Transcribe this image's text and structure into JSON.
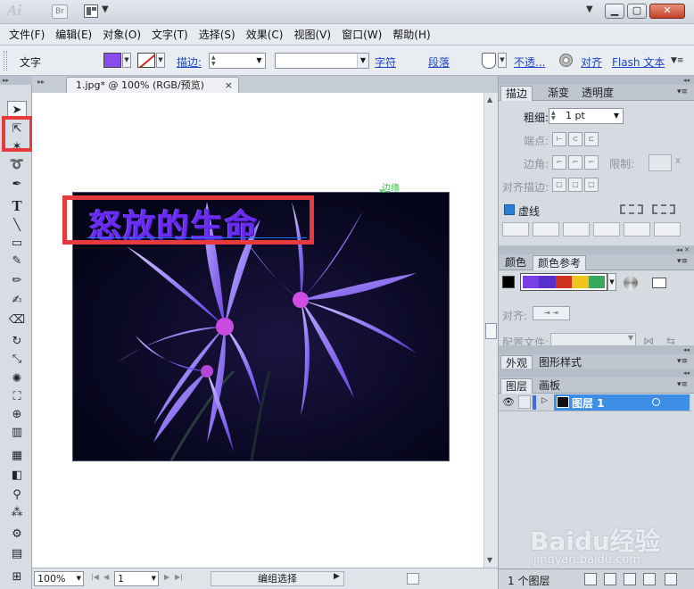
{
  "titlebar": {
    "app_logo": "Ai",
    "bridge_label": "Br"
  },
  "menu": [
    "文件(F)",
    "编辑(E)",
    "对象(O)",
    "文字(T)",
    "选择(S)",
    "效果(C)",
    "视图(V)",
    "窗口(W)",
    "帮助(H)"
  ],
  "control_bar": {
    "mode_label": "文字",
    "fill_color": "#8a4cf0",
    "stroke_link": "描边:",
    "char_link": "字符",
    "para_link": "段落",
    "opacity_link": "不透...",
    "align_link": "对齐",
    "flash_link": "Flash 文本"
  },
  "document": {
    "tab_title": "1.jpg* @ 100% (RGB/预览)",
    "tab_close": "×",
    "artwork_text": "怒放的生命",
    "edge_hint": "边缘",
    "artwork_text_color": "#6a2cf2"
  },
  "status_bar": {
    "zoom": "100%",
    "page": "1",
    "status_text": "编组选择"
  },
  "stroke_panel": {
    "tabs": [
      "描边",
      "渐变",
      "透明度"
    ],
    "weight_label": "粗细:",
    "weight_value": "1 pt",
    "cap_label": "端点:",
    "corner_label": "边角:",
    "limit_label": "限制:",
    "align_label": "对齐描边:",
    "dashed_label": "虚线"
  },
  "color_panel": {
    "tabs": [
      "颜色",
      "颜色参考"
    ],
    "harmony_colors": [
      "#7b3fe6",
      "#5a2fd0",
      "#d2331e",
      "#eec51a",
      "#3aa85a"
    ],
    "align_label": "对齐:",
    "profile_label": "配置文件:"
  },
  "appearance_panel": {
    "tabs": [
      "外观",
      "图形样式"
    ]
  },
  "layers_panel": {
    "tabs": [
      "图层",
      "画板"
    ],
    "layer_name": "图层 1",
    "layer_color": "#3c6ce0",
    "layer_count": "1 个图层"
  },
  "watermark": {
    "brand": "Baidu经验",
    "url": "jingyan.baidu.com"
  }
}
